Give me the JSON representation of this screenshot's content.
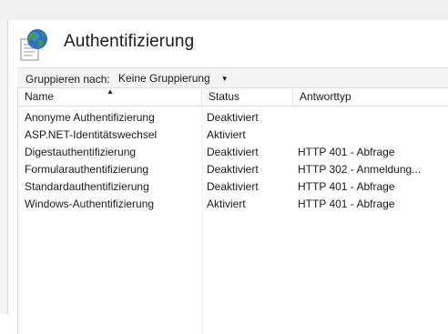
{
  "page": {
    "title": "Authentifizierung",
    "icon": "globe-page-icon"
  },
  "toolbar": {
    "group_label": "Gruppieren nach:",
    "group_value": "Keine Gruppierung"
  },
  "table": {
    "columns": {
      "name": "Name",
      "status": "Status",
      "response_type": "Antworttyp"
    },
    "sort": {
      "column": "name",
      "direction": "ascending"
    },
    "rows": [
      {
        "name": "Anonyme Authentifizierung",
        "status": "Deaktiviert",
        "response_type": ""
      },
      {
        "name": "ASP.NET-Identitätswechsel",
        "status": "Aktiviert",
        "response_type": ""
      },
      {
        "name": "Digestauthentifizierung",
        "status": "Deaktiviert",
        "response_type": "HTTP 401 - Abfrage"
      },
      {
        "name": "Formularauthentifizierung",
        "status": "Deaktiviert",
        "response_type": "HTTP 302 - Anmeldung..."
      },
      {
        "name": "Standardauthentifizierung",
        "status": "Deaktiviert",
        "response_type": "HTTP 401 - Abfrage"
      },
      {
        "name": "Windows-Authentifizierung",
        "status": "Aktiviert",
        "response_type": "HTTP 401 - Abfrage"
      }
    ]
  },
  "colors": {
    "globe_blue": "#2f6fc4",
    "globe_green": "#3aa145",
    "header_bg": "#f0f0f0"
  }
}
